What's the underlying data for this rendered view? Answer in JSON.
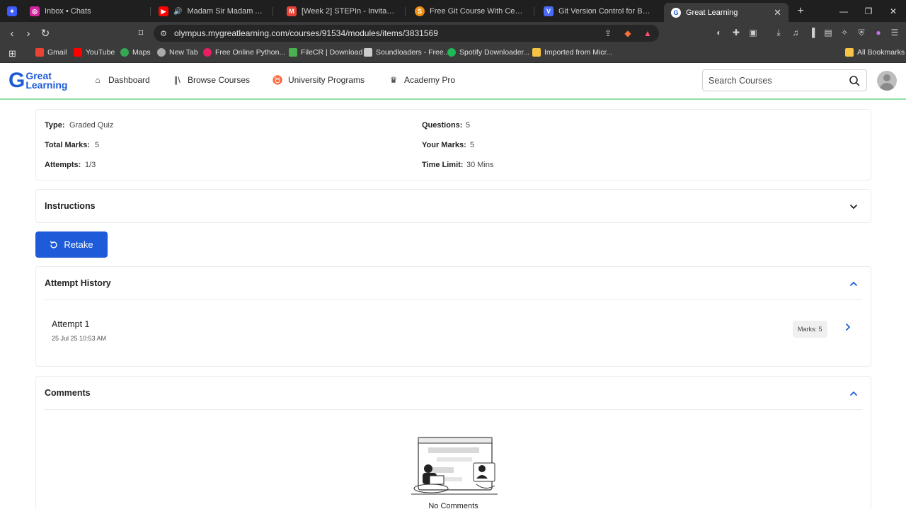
{
  "browser": {
    "tabs": [
      {
        "label": "Inbox • Chats",
        "icon": "instagram-icon",
        "color": "#d6249f"
      },
      {
        "label": "Madam Sir Madam Anthe | Vid",
        "icon": "youtube-icon",
        "color": "#ff0000"
      },
      {
        "label": "[Week 2] STEPIn - Invitation for \"Cc",
        "icon": "gmail-icon",
        "color": "#ea4335"
      },
      {
        "label": "Free Git Course With Certification |",
        "icon": "course-icon",
        "color": "#f29111"
      },
      {
        "label": "Git Version Control for Beginners |",
        "icon": "vcs-icon",
        "color": "#4a6cf7"
      },
      {
        "label": "Great Learning",
        "icon": "greatlearning-icon",
        "color": "#1d5bd8"
      }
    ],
    "url": "olympus.mygreatlearning.com/courses/91534/modules/items/3831569",
    "bookmarks": [
      {
        "label": "Gmail",
        "color": "#ea4335"
      },
      {
        "label": "YouTube",
        "color": "#ff0000"
      },
      {
        "label": "Maps",
        "color": "#34a853"
      },
      {
        "label": "New Tab",
        "color": "#aaaaaa"
      },
      {
        "label": "Free Online Python...",
        "color": "#e91e63"
      },
      {
        "label": "FileCR | Download",
        "color": "#4caf50"
      },
      {
        "label": "Soundloaders - Free...",
        "color": "#cccccc"
      },
      {
        "label": "Spotify Downloader...",
        "color": "#1db954"
      },
      {
        "label": "Imported from Micr...",
        "color": "#f6c343"
      }
    ],
    "all_bookmarks": "All Bookmarks"
  },
  "site": {
    "logo_line1": "Great",
    "logo_line2": "Learning",
    "nav": [
      "Dashboard",
      "Browse Courses",
      "University Programs",
      "Academy Pro"
    ],
    "search_placeholder": "Search Courses"
  },
  "quiz_info": {
    "type_label": "Type:",
    "type_value": "Graded Quiz",
    "total_label": "Total Marks:",
    "total_value": "5",
    "attempts_label": "Attempts:",
    "attempts_value": "1/3",
    "questions_label": "Questions:",
    "questions_value": "5",
    "your_label": "Your Marks:",
    "your_value": "5",
    "time_label": "Time Limit:",
    "time_value": "30 Mins"
  },
  "instructions_title": "Instructions",
  "retake_label": "Retake",
  "attempt_history": {
    "title": "Attempt History",
    "items": [
      {
        "title": "Attempt 1",
        "date": "25 Jul 25 10:53 AM",
        "marks": "Marks: 5"
      }
    ]
  },
  "comments": {
    "title": "Comments",
    "empty_text": "No Comments"
  },
  "colors": {
    "accent": "#1d5bd8",
    "success_border": "#8fe0a6"
  }
}
